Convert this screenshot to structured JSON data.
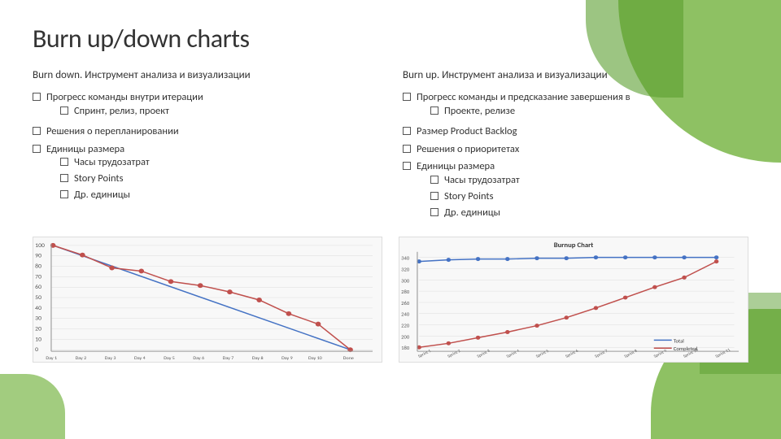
{
  "page": {
    "title": "Burn up/down charts"
  },
  "left": {
    "title": "Burn down. Инструмент анализа и визуализации",
    "items": [
      {
        "label": "Прогресс команды внутри итерации",
        "sub": [
          "Спринт, релиз, проект"
        ]
      },
      {
        "label": "Решения о перепланировании",
        "sub": []
      },
      {
        "label": "Единицы размера",
        "sub": [
          "Часы трудозатрат",
          "Story Points",
          "Др. единицы"
        ]
      }
    ]
  },
  "right": {
    "title": "Burn up. Инструмент анализа и визуализации",
    "items": [
      {
        "label": "Прогресс команды и предсказание завершения в",
        "sub": [
          "Проекте, релизе"
        ]
      },
      {
        "label": "Размер Product Backlog",
        "sub": []
      },
      {
        "label": "Решения о приоритетах",
        "sub": []
      },
      {
        "label": "Единицы размера",
        "sub": [
          "Часы трудозатрат",
          "Story Points",
          "Др. единицы"
        ]
      }
    ]
  },
  "burndown_chart": {
    "title": "",
    "y_max": 100,
    "y_labels": [
      "100",
      "90",
      "80",
      "70",
      "60",
      "50",
      "40",
      "30",
      "20",
      "10",
      "0"
    ],
    "x_labels": [
      "Day 1",
      "Day 2",
      "Day 3",
      "Day 4",
      "Day 5",
      "Day 6",
      "Day 7",
      "Day 8",
      "Day 9",
      "Day 10",
      "Done"
    ]
  },
  "burnup_chart": {
    "title": "Burnup Chart"
  }
}
